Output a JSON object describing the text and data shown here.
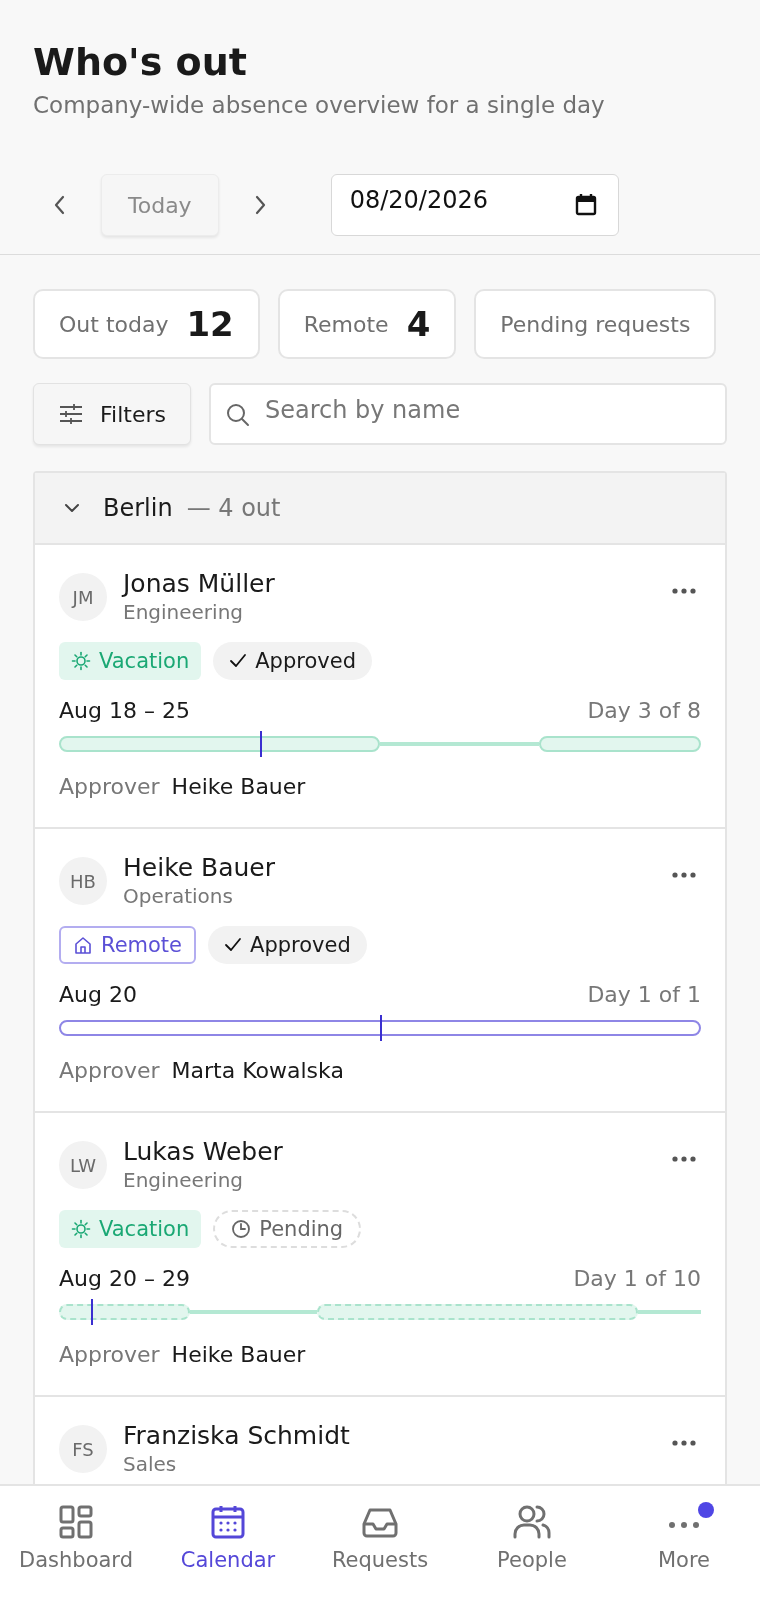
{
  "header": {
    "title": "Who's out",
    "subtitle": "Company-wide absence overview for a single day"
  },
  "date_nav": {
    "today_button": {
      "label": "Today",
      "disabled": true
    },
    "date_field": {
      "value": "08/20/2026"
    }
  },
  "stats": [
    {
      "label": "Out today",
      "value": "12"
    },
    {
      "label": "Remote",
      "value": "4"
    },
    {
      "label": "Pending requests"
    }
  ],
  "filters_button": {
    "label": "Filters"
  },
  "search": {
    "placeholder": "Search by name"
  },
  "groups": [
    {
      "name": "Berlin",
      "summary": "— 4 out",
      "expanded": true,
      "people": [
        {
          "initials": "JM",
          "name": "Jonas Müller",
          "department": "Engineering",
          "type": {
            "kind": "vacation",
            "label": "Vacation"
          },
          "status": {
            "kind": "approved",
            "label": "Approved"
          },
          "dates": "Aug 18 – 25",
          "progress": "Day 3 of 8",
          "days": [
            {
              "kind": "workday"
            },
            {
              "kind": "workday"
            },
            {
              "kind": "workday"
            },
            {
              "kind": "workday"
            },
            {
              "kind": "weekend"
            },
            {
              "kind": "weekend"
            },
            {
              "kind": "workday"
            },
            {
              "kind": "workday"
            }
          ],
          "today": {
            "level": 0.3125
          },
          "approver_label": "Approver",
          "approver": "Heike Bauer"
        },
        {
          "initials": "HB",
          "name": "Heike Bauer",
          "department": "Operations",
          "type": {
            "kind": "remote",
            "label": "Remote"
          },
          "status": {
            "kind": "approved",
            "label": "Approved"
          },
          "dates": "Aug 20",
          "progress": "Day 1 of 1",
          "days": [
            {
              "kind": "workday"
            }
          ],
          "today": {
            "level": 0.5
          },
          "approver_label": "Approver",
          "approver": "Marta Kowalska"
        },
        {
          "initials": "LW",
          "name": "Lukas Weber",
          "department": "Engineering",
          "type": {
            "kind": "vacation",
            "label": "Vacation"
          },
          "status": {
            "kind": "pending",
            "label": "Pending"
          },
          "dates": "Aug 20 – 29",
          "progress": "Day 1 of 10",
          "days": [
            {
              "kind": "workday"
            },
            {
              "kind": "workday"
            },
            {
              "kind": "weekend"
            },
            {
              "kind": "weekend"
            },
            {
              "kind": "workday"
            },
            {
              "kind": "workday"
            },
            {
              "kind": "workday"
            },
            {
              "kind": "workday"
            },
            {
              "kind": "workday"
            },
            {
              "kind": "weekend"
            }
          ],
          "today": {
            "level": 0.05
          },
          "approver_label": "Approver",
          "approver": "Heike Bauer"
        },
        {
          "initials": "FS",
          "name": "Franziska Schmidt",
          "department": "Sales"
        }
      ]
    }
  ],
  "nav": [
    {
      "kind": "dashboard",
      "label": "Dashboard",
      "selected": false,
      "badge": false
    },
    {
      "kind": "calendar",
      "label": "Calendar",
      "selected": true,
      "badge": false
    },
    {
      "kind": "requests",
      "label": "Requests",
      "selected": false,
      "badge": false
    },
    {
      "kind": "people",
      "label": "People",
      "selected": false,
      "badge": false
    },
    {
      "kind": "more",
      "label": "More",
      "selected": false,
      "badge": true
    }
  ]
}
